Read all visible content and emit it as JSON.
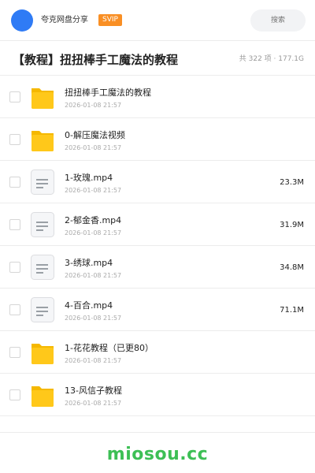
{
  "header": {
    "share_name": "夸克网盘分享",
    "badge": "SVIP",
    "search_placeholder": "搜索"
  },
  "folder": {
    "title": "【教程】扭扭棒手工魔法的教程",
    "meta": "共 322 项 · 177.1G"
  },
  "colors": {
    "avatar": "#2f7bf5",
    "svip": "#f98f24",
    "folder_icon": "#ffc81a",
    "brand": "#3dbf55"
  },
  "files": [
    {
      "type": "folder",
      "icon": "folder-icon",
      "name": "扭扭棒手工魔法的教程",
      "date": "2026-01-08 21:57",
      "size": ""
    },
    {
      "type": "folder",
      "icon": "folder-icon",
      "name": "0-解压魔法视频",
      "date": "2026-01-08 21:57",
      "size": ""
    },
    {
      "type": "video",
      "icon": "file-icon",
      "name": "1-玫瑰.mp4",
      "date": "2026-01-08 21:57",
      "size": "23.3M"
    },
    {
      "type": "video",
      "icon": "file-icon",
      "name": "2-郁金香.mp4",
      "date": "2026-01-08 21:57",
      "size": "31.9M"
    },
    {
      "type": "video",
      "icon": "file-icon",
      "name": "3-绣球.mp4",
      "date": "2026-01-08 21:57",
      "size": "34.8M"
    },
    {
      "type": "video",
      "icon": "file-icon",
      "name": "4-百合.mp4",
      "date": "2026-01-08 21:57",
      "size": "71.1M"
    },
    {
      "type": "folder",
      "icon": "folder-icon",
      "name": "1-花花教程（已更80）",
      "date": "2026-01-08 21:57",
      "size": ""
    },
    {
      "type": "folder",
      "icon": "folder-icon",
      "name": "13-风信子教程",
      "date": "2026-01-08 21:57",
      "size": ""
    }
  ],
  "footer": {
    "brand": "miosou.cc"
  }
}
